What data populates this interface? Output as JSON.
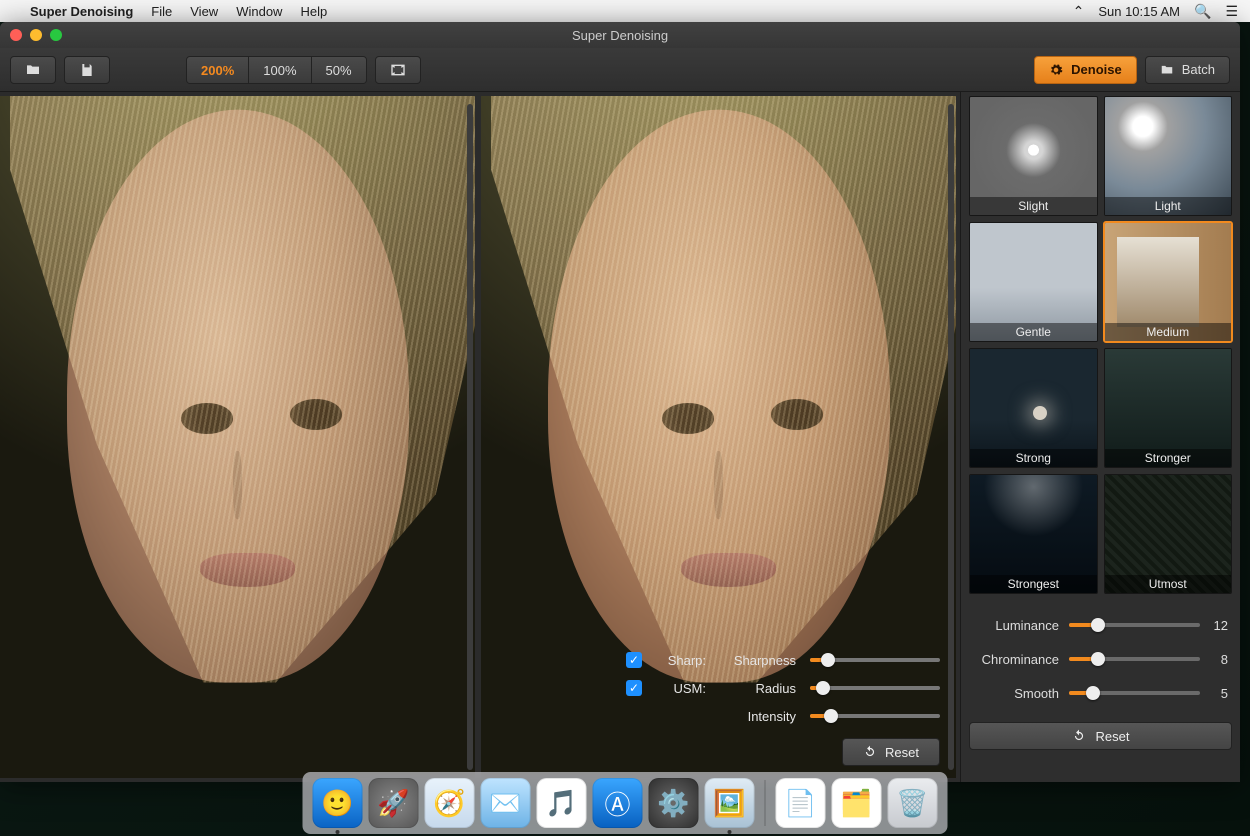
{
  "menubar": {
    "app_name": "Super Denoising",
    "items": [
      "File",
      "View",
      "Window",
      "Help"
    ],
    "clock": "Sun 10:15 AM"
  },
  "window": {
    "title": "Super Denoising"
  },
  "toolbar": {
    "zoom_options": [
      "200%",
      "100%",
      "50%"
    ],
    "zoom_active_index": 0
  },
  "modes": {
    "denoise_label": "Denoise",
    "batch_label": "Batch",
    "active": "denoise"
  },
  "overlay": {
    "sharp_checkbox_label": "Sharp:",
    "usm_checkbox_label": "USM:",
    "sharp_checked": true,
    "usm_checked": true,
    "rows": [
      {
        "label": "Sharpness",
        "percent": 14
      },
      {
        "label": "Radius",
        "percent": 10
      },
      {
        "label": "Intensity",
        "percent": 16
      }
    ],
    "reset_label": "Reset"
  },
  "presets": [
    {
      "label": "Slight",
      "thumb": "th-slight",
      "selected": false
    },
    {
      "label": "Light",
      "thumb": "th-light",
      "selected": false
    },
    {
      "label": "Gentle",
      "thumb": "th-gentle",
      "selected": false
    },
    {
      "label": "Medium",
      "thumb": "th-medium",
      "selected": true
    },
    {
      "label": "Strong",
      "thumb": "th-strong",
      "selected": false
    },
    {
      "label": "Stronger",
      "thumb": "th-stronger",
      "selected": false
    },
    {
      "label": "Strongest",
      "thumb": "th-strongest",
      "selected": false
    },
    {
      "label": "Utmost",
      "thumb": "th-utmost",
      "selected": false
    }
  ],
  "sliders": [
    {
      "label": "Luminance",
      "value": 12,
      "percent": 22
    },
    {
      "label": "Chrominance",
      "value": 8,
      "percent": 22
    },
    {
      "label": "Smooth",
      "value": 5,
      "percent": 18
    }
  ],
  "reset_label": "Reset",
  "dock": {
    "apps": [
      "finder",
      "launchpad",
      "safari",
      "mail",
      "itunes",
      "appstore",
      "settings",
      "preview"
    ],
    "docs": [
      "doc",
      "photos",
      "trash"
    ]
  },
  "colors": {
    "accent": "#f28a1e"
  }
}
